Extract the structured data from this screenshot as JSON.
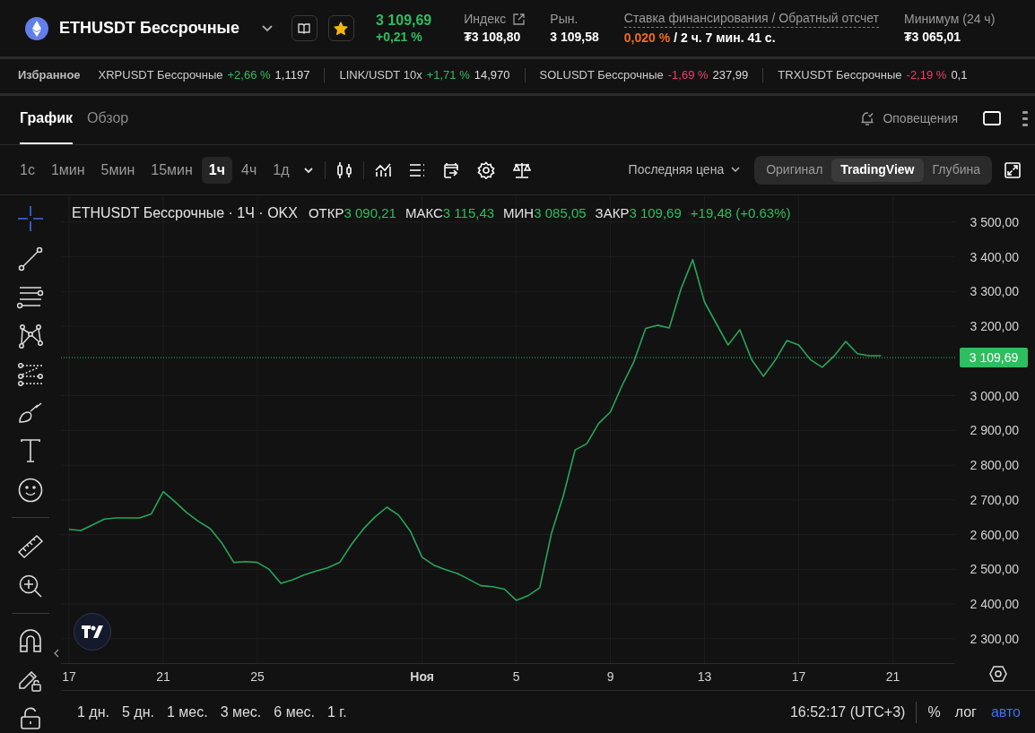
{
  "header": {
    "symbol": "ETHUSDT Бессрочные",
    "favorite": true,
    "price": "3 109,69",
    "change": "+0,21 %",
    "stats": [
      {
        "kind": "link",
        "label": "Индекс",
        "value": "₮3 108,80"
      },
      {
        "kind": "plain",
        "label": "Рын.",
        "value": "3 109,58"
      },
      {
        "kind": "funding",
        "label": "Ставка финансирования / Обратный отсчет",
        "rate": "0,020 %",
        "countdown": "/ 2 ч. 7 мин. 41 с."
      },
      {
        "kind": "plain",
        "label": "Минимум (24 ч)",
        "value": "₮3 065,01"
      }
    ]
  },
  "favorites": {
    "title": "Избранное",
    "items": [
      {
        "name": "XRPUSDT Бессрочные",
        "change": "+2,66 %",
        "color": "#2ebd5f",
        "price": "1,1197"
      },
      {
        "name": "LINK/USDT 10x",
        "change": "+1,71 %",
        "color": "#2ebd5f",
        "price": "14,970"
      },
      {
        "name": "SOLUSDT Бессрочные",
        "change": "-1,69 %",
        "color": "#e8426a",
        "price": "237,99"
      },
      {
        "name": "TRXUSDT Бессрочные",
        "change": "-2,19 %",
        "color": "#e8426a",
        "price": "0,1"
      }
    ]
  },
  "tabs": [
    {
      "label": "График",
      "selected": true
    },
    {
      "label": "Обзор",
      "selected": false
    }
  ],
  "alerts_label": "Оповещения",
  "intervals": [
    {
      "label": "1с",
      "selected": false
    },
    {
      "label": "1мин",
      "selected": false
    },
    {
      "label": "5мин",
      "selected": false
    },
    {
      "label": "15мин",
      "selected": false
    },
    {
      "label": "1ч",
      "selected": true
    },
    {
      "label": "4ч",
      "selected": false
    },
    {
      "label": "1д",
      "selected": false
    }
  ],
  "price_source": "Последняя цена",
  "view_modes": [
    {
      "label": "Оригинал",
      "selected": false
    },
    {
      "label": "TradingView",
      "selected": true
    },
    {
      "label": "Глубина",
      "selected": false
    }
  ],
  "chart": {
    "legend": {
      "title": "ETHUSDT Бессрочные · 1Ч · OKX",
      "fields": [
        {
          "label": "ОТКР",
          "value": "3 090,21"
        },
        {
          "label": "МАКС",
          "value": "3 115,43"
        },
        {
          "label": "МИН",
          "value": "3 085,05"
        },
        {
          "label": "ЗАКР",
          "value": "3 109,69"
        }
      ],
      "change": "+19,48 (+0.63%)"
    },
    "chart_data": {
      "type": "line",
      "grid": true,
      "ylim": [
        2230,
        3577
      ],
      "categories": [
        "17",
        null,
        null,
        null,
        null,
        null,
        null,
        null,
        "21",
        null,
        null,
        null,
        null,
        null,
        null,
        null,
        "25",
        null,
        null,
        null,
        null,
        null,
        null,
        null,
        null,
        null,
        null,
        null,
        null,
        null,
        "**Ноя**",
        null,
        null,
        null,
        null,
        null,
        null,
        null,
        "5",
        null,
        null,
        null,
        null,
        null,
        null,
        null,
        "9",
        null,
        null,
        null,
        null,
        null,
        null,
        null,
        "13",
        null,
        null,
        null,
        null,
        null,
        null,
        null,
        "17",
        null,
        null,
        null,
        null,
        null,
        null,
        null,
        "21"
      ],
      "yticks": [
        {
          "value": 2300,
          "label": "2 300,00"
        },
        {
          "value": 2400,
          "label": "2 400,00"
        },
        {
          "value": 2500,
          "label": "2 500,00"
        },
        {
          "value": 2600,
          "label": "2 600,00"
        },
        {
          "value": 2700,
          "label": "2 700,00"
        },
        {
          "value": 2800,
          "label": "2 800,00"
        },
        {
          "value": 2900,
          "label": "2 900,00"
        },
        {
          "value": 3000,
          "label": "3 000,00"
        },
        {
          "value": 3200,
          "label": "3 200,00"
        },
        {
          "value": 3300,
          "label": "3 300,00"
        },
        {
          "value": 3400,
          "label": "3 400,00"
        },
        {
          "value": 3500,
          "label": "3 500,00"
        }
      ],
      "series": [
        {
          "color": "#26a65b",
          "values": [
            2615,
            2612,
            2628,
            2645,
            2648,
            2648,
            2648,
            2660,
            2724,
            2695,
            2663,
            2638,
            2617,
            2575,
            2520,
            2522,
            2520,
            2500,
            2460,
            2470,
            2484,
            2495,
            2505,
            2520,
            2572,
            2616,
            2651,
            2679,
            2656,
            2610,
            2535,
            2512,
            2499,
            2488,
            2471,
            2453,
            2450,
            2443,
            2411,
            2424,
            2447,
            2605,
            2712,
            2844,
            2862,
            2920,
            2953,
            3030,
            3098,
            3194,
            3203,
            3195,
            3308,
            3392,
            3270,
            3208,
            3146,
            3190,
            3104,
            3056,
            3102,
            3159,
            3146,
            3104,
            3082,
            3114,
            3156,
            3121,
            3115,
            3115,
            null
          ]
        }
      ],
      "ref_lines": [
        {
          "axis": "y",
          "value": 3109.69,
          "label": "3 109,69",
          "color": "#2ebd5f"
        }
      ]
    }
  },
  "ranges": [
    "1 дн.",
    "5 дн.",
    "1 мес.",
    "3 мес.",
    "6 мес.",
    "1 г."
  ],
  "clock": "16:52:17 (UTC+3)",
  "scale_options": [
    {
      "label": "%",
      "selected": false
    },
    {
      "label": "лог",
      "selected": false
    },
    {
      "label": "авто",
      "selected": true
    }
  ]
}
